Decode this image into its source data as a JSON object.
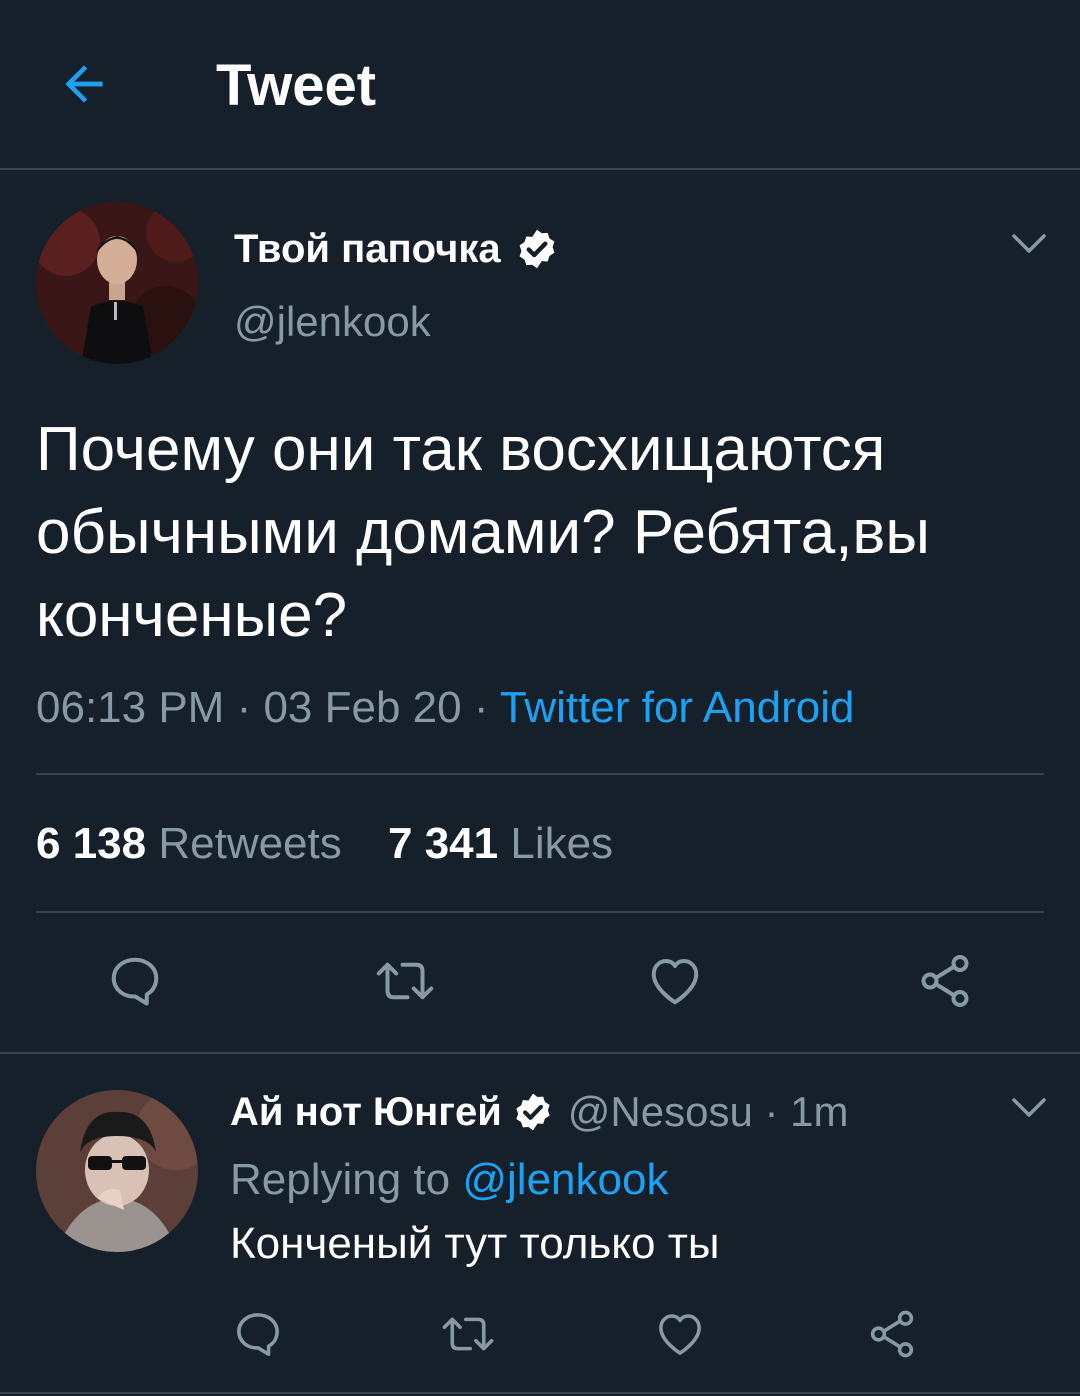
{
  "header": {
    "title": "Tweet",
    "back_icon": "arrow-left-icon"
  },
  "colors": {
    "background": "#15202b",
    "divider": "#38444d",
    "accent": "#1da1f2",
    "secondary_text": "#8899a6"
  },
  "tweet": {
    "author_name": "Твой папочка",
    "verified": true,
    "handle": "@jlenkook",
    "text": "Почему они так восхищаются\nобычными домами? Ребята,вы\nконченые?",
    "time": "06:13 PM",
    "date": "03 Feb 20",
    "separator": " · ",
    "source": "Twitter for Android",
    "retweets_count": "6 138",
    "retweets_label": "Retweets",
    "likes_count": "7 341",
    "likes_label": "Likes",
    "actions": [
      "reply-icon",
      "retweet-icon",
      "like-icon",
      "share-icon"
    ]
  },
  "reply": {
    "author_name": "Ай нот Юнгей",
    "verified": true,
    "handle_time": "@Nesosu · 1m",
    "replying_prefix": "Replying to ",
    "replying_to": "@jlenkook",
    "text": "Конченый тут только ты",
    "actions": [
      "reply-icon",
      "retweet-icon",
      "like-icon",
      "share-icon"
    ]
  }
}
